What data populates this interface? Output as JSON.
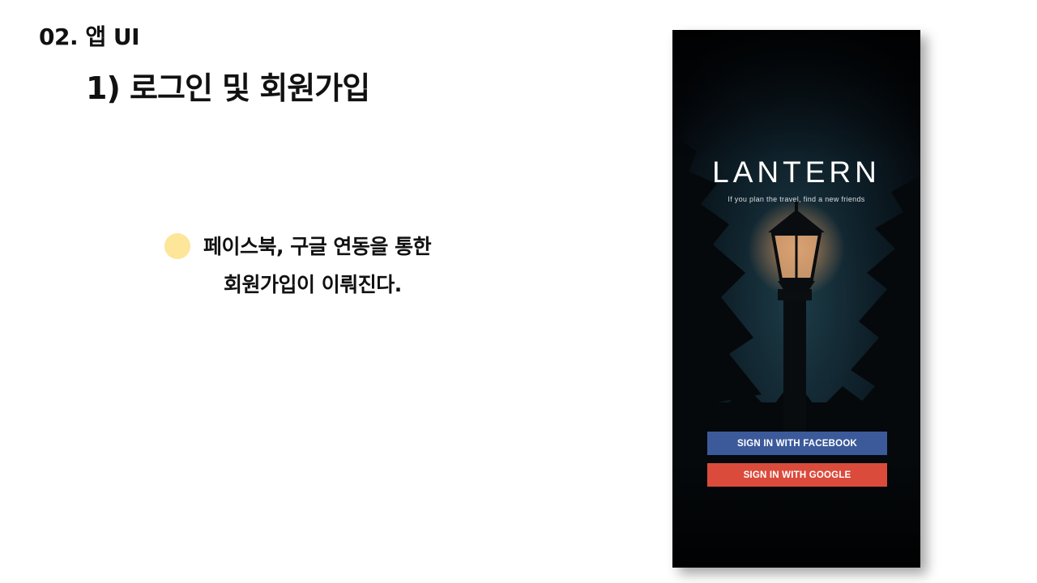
{
  "slide": {
    "section_title": "02. 앱 UI",
    "sub_title": "1) 로그인 및 회원가입",
    "description_line1": "페이스북, 구글 연동을 통한",
    "description_line2": "회원가입이 이뤄진다.",
    "bullet_color": "#fde59a"
  },
  "app": {
    "title": "LANTERN",
    "tagline": "If you plan the travel, find a new friends",
    "facebook_button_label": "SIGN IN WITH FACEBOOK",
    "google_button_label": "SIGN IN WITH GOOGLE",
    "facebook_color": "#3c5a9a",
    "google_color": "#db4b3c",
    "background_image": "night-lantern-photo"
  }
}
